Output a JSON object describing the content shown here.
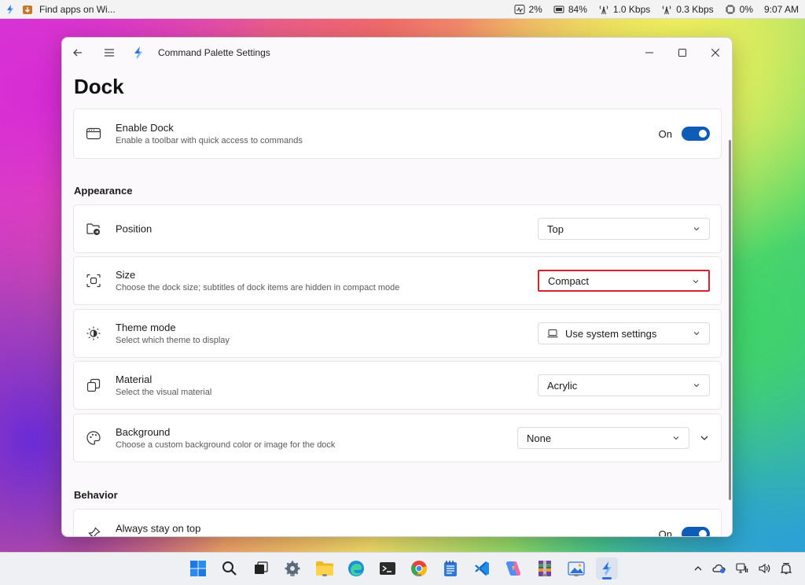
{
  "topbar": {
    "app_text": "Find apps on Wi...",
    "cpu": "2%",
    "battery": "84%",
    "download": "1.0 Kbps",
    "upload": "0.3 Kbps",
    "memory": "0%",
    "time": "9:07 AM"
  },
  "window": {
    "title": "Command Palette Settings"
  },
  "page": {
    "title": "Dock"
  },
  "enable_dock": {
    "label": "Enable Dock",
    "desc": "Enable a toolbar with quick access to commands",
    "state": "On"
  },
  "sections": {
    "appearance": "Appearance",
    "behavior": "Behavior"
  },
  "position": {
    "label": "Position",
    "value": "Top"
  },
  "size": {
    "label": "Size",
    "desc": "Choose the dock size; subtitles of dock items are hidden in compact mode",
    "value": "Compact"
  },
  "theme": {
    "label": "Theme mode",
    "desc": "Select which theme to display",
    "value": "Use system settings"
  },
  "material": {
    "label": "Material",
    "desc": "Select the visual material",
    "value": "Acrylic"
  },
  "background": {
    "label": "Background",
    "desc": "Choose a custom background color or image for the dock",
    "value": "None"
  },
  "always_on_top": {
    "label": "Always stay on top",
    "state": "On"
  },
  "colors": {
    "accent": "#0f5cb8",
    "highlight": "#d6232f"
  }
}
